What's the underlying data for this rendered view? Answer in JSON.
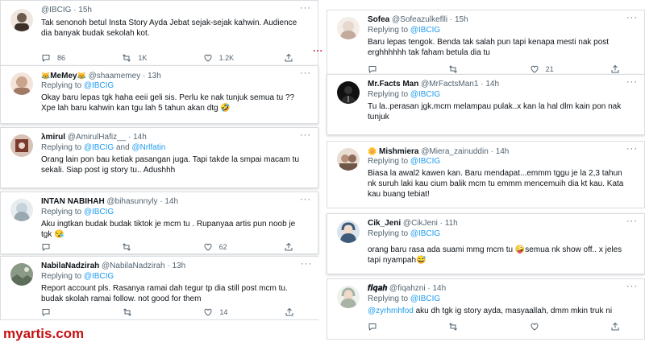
{
  "watermark": "myartis.com",
  "separator_dots": "...",
  "left_column": [
    {
      "name": "",
      "handle": "@IBCIG",
      "time": "15h",
      "avatar_color": "#6b5a4e",
      "replying_label": "",
      "replying_to": [],
      "text": "Tak senonoh betul Insta Story Ayda Jebat sejak-sejak kahwin. Audience dia banyak budak sekolah kot.",
      "counts": {
        "reply": "86",
        "retweet": "1K",
        "like": "1.2K"
      }
    },
    {
      "name": "MeMey",
      "name_prefix_emoji": "😹",
      "name_suffix_emoji": "😹",
      "handle": "@shaamemey",
      "time": "13h",
      "avatar_color": "#c9a38c",
      "replying_label": "Replying to",
      "replying_to": [
        "@IBCIG"
      ],
      "text": "Okay baru lepas tgk haha eeii geli sis. Perlu ke nak tunjuk semua tu ?? Xpe lah baru kahwin kan tgu lah 5 tahun akan dtg 🤣",
      "counts": null
    },
    {
      "name": "λmirul",
      "handle": "@AmirulHafiz__",
      "time": "14h",
      "avatar_color": "#7a3b2e",
      "replying_label": "Replying to",
      "replying_to": [
        "@IBCIG",
        "and",
        "@Nrlfatin"
      ],
      "text": "Orang lain pon bau ketiak pasangan juga. Tapi takde la smpai macam tu sekali. Siap post ig story tu.. Adushhh",
      "counts": null
    },
    {
      "name": "INTAN NABIHAH",
      "handle": "@bihasunnyly",
      "time": "14h",
      "avatar_color": "#9aa8b0",
      "replying_label": "Replying to",
      "replying_to": [
        "@IBCIG"
      ],
      "text": "Aku ingtkan budak budak tiktok je mcm tu . Rupanyaa artis pun noob je tgk 😪",
      "counts": {
        "reply": "",
        "retweet": "",
        "like": "62"
      }
    },
    {
      "name": "NabilaNadzirah",
      "handle": "@NabilaNadzirah",
      "time": "13h",
      "avatar_color": "#5c6e5a",
      "replying_label": "Replying to",
      "replying_to": [
        "@IBCIG"
      ],
      "text": "Report account pls. Rasanya ramai dah tegur tp dia still post mcm tu. budak skolah ramai follow. not good for them",
      "counts": {
        "reply": "",
        "retweet": "",
        "like": "14"
      }
    }
  ],
  "right_column": [
    {
      "name": "Sofea",
      "handle": "@Sofeazulkeflli",
      "time": "15h",
      "avatar_color": "#e6d8cf",
      "replying_label": "Replying to",
      "replying_to": [
        "@IBCIG"
      ],
      "text": "Baru lepas tengok. Benda tak salah pun tapi kenapa mesti nak post erghhhhhh tak faham betula dia tu",
      "counts": {
        "reply": "",
        "retweet": "",
        "like": "21"
      }
    },
    {
      "name": "Mr.Facts Man",
      "handle": "@MrFactsMan1",
      "time": "14h",
      "avatar_color": "#1d1d1d",
      "replying_label": "Replying to",
      "replying_to": [
        "@IBCIG"
      ],
      "text": "Tu la..perasan jgk.mcm melampau pulak..x kan la hal dlm kain pon nak tunjuk",
      "counts": null
    },
    {
      "name": "Mishmiera",
      "name_prefix_emoji": "🌼",
      "handle": "@Miera_zainuddin",
      "time": "14h",
      "avatar_color": "#b58e7a",
      "replying_label": "Replying to",
      "replying_to": [
        "@IBCIG"
      ],
      "text": "Biasa la awal2 kawen kan. Baru mendapat...emmm tggu je la 2,3 tahun nk suruh laki kau cium balik mcm tu emmm mencemuih dia kt kau. Kata kau buang tebiat!",
      "counts": null
    },
    {
      "name": "Cik_Jeni",
      "handle": "@CikJeni",
      "time": "11h",
      "avatar_color": "#3d5a78",
      "replying_label": "Replying to",
      "replying_to": [
        "@IBCIG"
      ],
      "text": "orang baru rasa ada suami mmg mcm tu 🤪semua nk show off.. x jeles tapi nyampah😅",
      "counts": null
    },
    {
      "name": "𝒇𝒊𝒒𝒂𝒉",
      "handle": "@fiqahzni",
      "time": "14h",
      "avatar_color": "#a7b3a5",
      "replying_label": "Replying to",
      "replying_to": [
        "@IBCIG"
      ],
      "text_mention": "@zyrhmhfod",
      "text": "aku dh tgk ig story ayda, masyaallah, dmm mkin truk ni",
      "counts": {
        "reply": "",
        "retweet": "",
        "like": ""
      }
    }
  ],
  "icons": {
    "reply": "reply-icon",
    "retweet": "retweet-icon",
    "like": "like-icon",
    "share": "share-icon",
    "menu": "more-menu-icon"
  },
  "colors": {
    "mention": "#1d9bf0",
    "muted": "#536471",
    "watermark": "#c41212"
  }
}
